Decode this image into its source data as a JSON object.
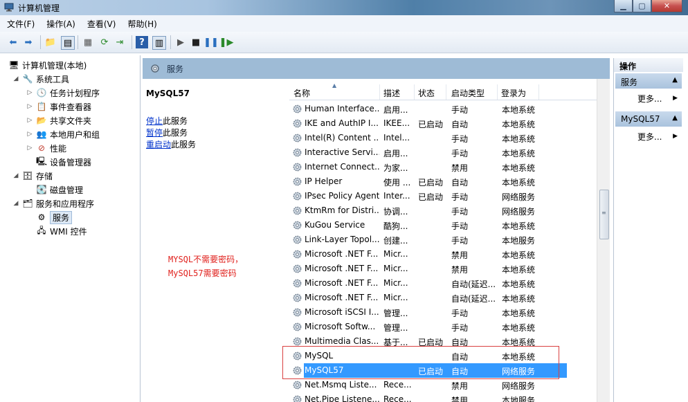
{
  "window": {
    "title": "计算机管理",
    "controls": [
      "minimize",
      "maximize",
      "close"
    ]
  },
  "menu": [
    "文件(F)",
    "操作(A)",
    "查看(V)",
    "帮助(H)"
  ],
  "tree": {
    "root": "计算机管理(本地)",
    "system_tools": "系统工具",
    "task_scheduler": "任务计划程序",
    "event_viewer": "事件查看器",
    "shared_folders": "共享文件夹",
    "local_users": "本地用户和组",
    "performance": "性能",
    "device_manager": "设备管理器",
    "storage": "存储",
    "disk_management": "磁盘管理",
    "services_apps": "服务和应用程序",
    "services": "服务",
    "wmi": "WMI 控件"
  },
  "services_header": "服务",
  "detail": {
    "service_name": "MySQL57",
    "stop_link": "停止",
    "stop_rest": "此服务",
    "pause_link": "暂停",
    "pause_rest": "此服务",
    "restart_link": "重启动",
    "restart_rest": "此服务"
  },
  "annotation": {
    "line1": "MYSQL不需要密码，",
    "line2": "MySQL57需要密码"
  },
  "columns": {
    "name": "名称",
    "desc": "描述",
    "status": "状态",
    "startup": "启动类型",
    "logon": "登录为"
  },
  "services": [
    {
      "name": "Human Interface...",
      "desc": "启用...",
      "status": "",
      "startup": "手动",
      "logon": "本地系统"
    },
    {
      "name": "IKE and AuthIP I...",
      "desc": "IKEE...",
      "status": "已启动",
      "startup": "自动",
      "logon": "本地系统"
    },
    {
      "name": "Intel(R) Content ...",
      "desc": "Intel...",
      "status": "",
      "startup": "手动",
      "logon": "本地系统"
    },
    {
      "name": "Interactive Servi...",
      "desc": "启用...",
      "status": "",
      "startup": "手动",
      "logon": "本地系统"
    },
    {
      "name": "Internet Connect...",
      "desc": "为家...",
      "status": "",
      "startup": "禁用",
      "logon": "本地系统"
    },
    {
      "name": "IP Helper",
      "desc": "使用 ...",
      "status": "已启动",
      "startup": "自动",
      "logon": "本地系统"
    },
    {
      "name": "IPsec Policy Agent",
      "desc": "Inter...",
      "status": "已启动",
      "startup": "手动",
      "logon": "网络服务"
    },
    {
      "name": "KtmRm for Distri...",
      "desc": "协调...",
      "status": "",
      "startup": "手动",
      "logon": "网络服务"
    },
    {
      "name": "KuGou Service",
      "desc": "酷狗...",
      "status": "",
      "startup": "手动",
      "logon": "本地系统"
    },
    {
      "name": "Link-Layer Topol...",
      "desc": "创建...",
      "status": "",
      "startup": "手动",
      "logon": "本地服务"
    },
    {
      "name": "Microsoft .NET F...",
      "desc": "Micr...",
      "status": "",
      "startup": "禁用",
      "logon": "本地系统"
    },
    {
      "name": "Microsoft .NET F...",
      "desc": "Micr...",
      "status": "",
      "startup": "禁用",
      "logon": "本地系统"
    },
    {
      "name": "Microsoft .NET F...",
      "desc": "Micr...",
      "status": "",
      "startup": "自动(延迟...",
      "logon": "本地系统"
    },
    {
      "name": "Microsoft .NET F...",
      "desc": "Micr...",
      "status": "",
      "startup": "自动(延迟...",
      "logon": "本地系统"
    },
    {
      "name": "Microsoft iSCSI I...",
      "desc": "管理...",
      "status": "",
      "startup": "手动",
      "logon": "本地系统"
    },
    {
      "name": "Microsoft Softw...",
      "desc": "管理...",
      "status": "",
      "startup": "手动",
      "logon": "本地系统"
    },
    {
      "name": "Multimedia Clas...",
      "desc": "基于...",
      "status": "已启动",
      "startup": "自动",
      "logon": "本地系统"
    },
    {
      "name": "MySQL",
      "desc": "",
      "status": "",
      "startup": "自动",
      "logon": "本地系统"
    },
    {
      "name": "MySQL57",
      "desc": "",
      "status": "已启动",
      "startup": "自动",
      "logon": "网络服务"
    },
    {
      "name": "Net.Msmq Liste...",
      "desc": "Rece...",
      "status": "",
      "startup": "禁用",
      "logon": "网络服务"
    },
    {
      "name": "Net.Pipe Listene...",
      "desc": "Rece...",
      "status": "",
      "startup": "禁用",
      "logon": "本地服务"
    }
  ],
  "actions": {
    "header": "操作",
    "section1": "服务",
    "more1": "更多...",
    "section2": "MySQL57",
    "more2": "更多..."
  }
}
